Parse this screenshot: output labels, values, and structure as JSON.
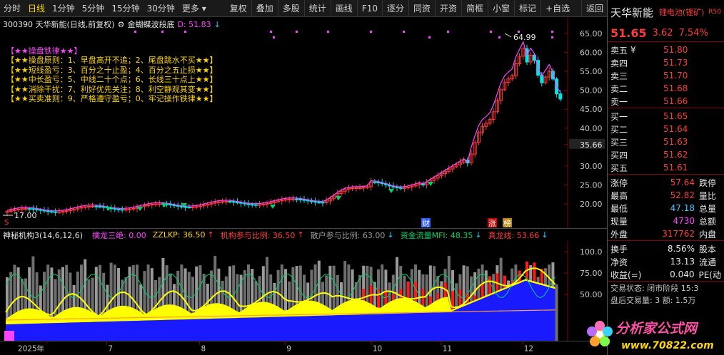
{
  "toolbar": {
    "periods": [
      "分时",
      "日线",
      "1分钟",
      "5分钟",
      "15分钟",
      "30分钟",
      "更多 ▾"
    ],
    "active_period": 1,
    "buttons": [
      "复权",
      "叠加",
      "多股",
      "统计",
      "画线",
      "F10",
      "逐分",
      "同资",
      "开资",
      "简框",
      "小窗",
      "标记",
      "+自选",
      "返回"
    ]
  },
  "stock": {
    "header": "300390 天华新能(日线,前复权)",
    "indicator_name": "金蝴蝶波段底",
    "d_value": "D: 51.83",
    "d_arrow": "↓"
  },
  "rules": {
    "title": "【★★操盘铁律★★】",
    "lines": [
      "【★★操盘原则：1、早盘高开不追；2、尾盘跳水不买★★】",
      "【★★短线盈亏：3、百分之十止盈；4、百分之五止损★★】",
      "【★★中长盈亏：5、中线二十个点；6、长线三十点上★★】",
      "【★★消除干扰：7、利好优先关注；8、利空静观其变★★】",
      "【★★买卖准则：9、严格遵守盈亏；0、牢记操作铁律★★】"
    ]
  },
  "price_axis": [
    "65.00",
    "60.00",
    "55.00",
    "50.00",
    "45.00",
    "40.00",
    "35.66",
    "30.00",
    "25.00",
    "20.00"
  ],
  "annotations": {
    "high": "64.99",
    "low": "17.00",
    "markers": [
      "财",
      "涨",
      "榜"
    ],
    "s_mark": "S"
  },
  "sub_header": {
    "name": "神秘机构3(14,6,12,6)",
    "items": [
      {
        "text": "擒龙三绝: 0.00",
        "color": "#ff44ff"
      },
      {
        "text": "ZZLKP: 36.50",
        "color": "#ffd700",
        "arrow": "↑",
        "arrow_color": "#ff3b3b"
      },
      {
        "text": "机构参与比例: 36.50",
        "color": "#ff3b3b",
        "arrow": "↑",
        "arrow_color": "#ff3b3b"
      },
      {
        "text": "散户参与比例: 63.00",
        "color": "#9a9a9a",
        "arrow": "↓",
        "arrow_color": "#33ccff"
      },
      {
        "text": "资金流量MFI: 48.35",
        "color": "#00d26a",
        "arrow": "↓",
        "arrow_color": "#33ccff"
      },
      {
        "text": "真龙线: 53.66",
        "color": "#ff3b3b",
        "arrow": "↓",
        "arrow_color": "#33ccff"
      }
    ]
  },
  "sub_axis": [
    "100.0",
    "75.00",
    "50.00"
  ],
  "date_axis": [
    "2025年",
    "7",
    "8",
    "9",
    "10",
    "11",
    "12"
  ],
  "quote": {
    "name": "天华新能",
    "sector": "锂电池(锂矿)",
    "tag": "R50",
    "price": "51.65",
    "change": "3.62",
    "pct": "7.54%",
    "asks": [
      {
        "label": "卖五",
        "mark": "¥",
        "price": "51.80"
      },
      {
        "label": "卖四",
        "mark": "",
        "price": "51.73"
      },
      {
        "label": "卖三",
        "mark": "",
        "price": "51.70"
      },
      {
        "label": "卖二",
        "mark": "",
        "price": "51.68"
      },
      {
        "label": "卖一",
        "mark": "",
        "price": "51.66"
      }
    ],
    "bids": [
      {
        "label": "买一",
        "price": "51.65"
      },
      {
        "label": "买二",
        "price": "51.64"
      },
      {
        "label": "买三",
        "price": "51.63"
      },
      {
        "label": "买四",
        "price": "51.62"
      },
      {
        "label": "买五",
        "price": "51.61"
      }
    ],
    "stats": [
      {
        "l1": "涨停",
        "v1": "57.64",
        "c1": "red",
        "l2": "跌停"
      },
      {
        "l1": "最高",
        "v1": "52.82",
        "c1": "red",
        "l2": "量比"
      },
      {
        "l1": "最低",
        "v1": "47.18",
        "c1": "cyan",
        "l2": "总量"
      },
      {
        "l1": "现量",
        "v1": "4730",
        "c1": "magenta",
        "l2": "总额"
      },
      {
        "l1": "外盘",
        "v1": "317762",
        "c1": "red",
        "l2": "内盘"
      }
    ],
    "stats2": [
      {
        "l1": "换手",
        "v1": "8.56%",
        "l2": "股本"
      },
      {
        "l1": "净资",
        "v1": "13.13",
        "l2": "流通"
      },
      {
        "l1": "收益(=)",
        "v1": "0.040",
        "l2": "PE(动"
      }
    ],
    "status": "交易状态: 闭市阶段 15:3",
    "after": "盘后交易量: 3  额: 1.5万"
  },
  "logo": {
    "text": "分析家公式网",
    "url": "www.70822.com"
  }
}
